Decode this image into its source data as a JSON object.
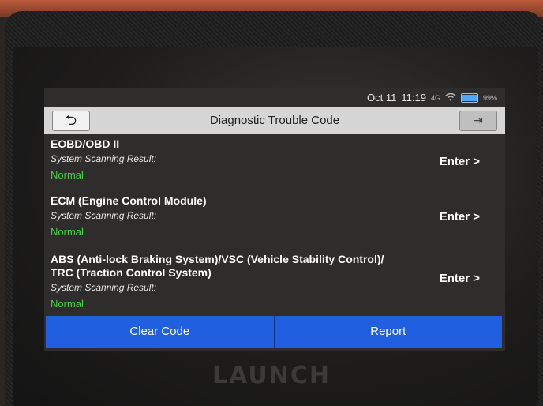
{
  "device": {
    "brand": "LAUNCH"
  },
  "status": {
    "date": "Oct 11",
    "time": "11:19",
    "battery": "99%",
    "signal": "4G"
  },
  "header": {
    "title": "Diagnostic Trouble Code",
    "back_icon": "back-arrow-icon",
    "exit_icon": "exit-icon"
  },
  "systems": [
    {
      "name": "EOBD/OBD II",
      "result_label": "System Scanning Result:",
      "result": "Normal",
      "action": "Enter >"
    },
    {
      "name": "ECM (Engine Control Module)",
      "result_label": "System Scanning Result:",
      "result": "Normal",
      "action": "Enter >"
    },
    {
      "name": "ABS (Anti-lock Braking System)/VSC (Vehicle Stability Control)/ TRC (Traction Control System)",
      "result_label": "System Scanning Result:",
      "result": "Normal",
      "action": "Enter >"
    }
  ],
  "footer": {
    "clear_code": "Clear Code",
    "report": "Report"
  },
  "colors": {
    "accent": "#1f5fe0",
    "normal": "#3fd43f",
    "titlebar": "#d6d6d6"
  }
}
